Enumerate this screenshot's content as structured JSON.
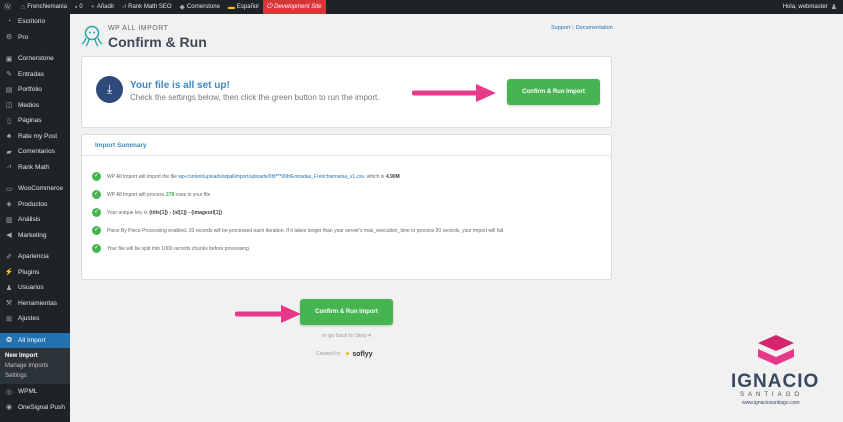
{
  "admin_bar": {
    "site_name": "Frenchiemania",
    "comments_count": "0",
    "add_new": "Añadir",
    "rank_math": "Rank Math SEO",
    "cornerstone": "Cornerstone",
    "language": "Español",
    "dev_site": "Development Site",
    "greeting": "Hola, webmaster"
  },
  "sidebar": {
    "items": [
      "Escritorio",
      "Pro",
      "Cornerstone",
      "Entradas",
      "Portfolio",
      "Medios",
      "Páginas",
      "Rate my Post",
      "Comentarios",
      "Rank Math",
      "WooCommerce",
      "Productos",
      "Análisis",
      "Marketing",
      "Apariencia",
      "Plugins",
      "Usuarios",
      "Herramientas",
      "Ajustes",
      "All Import"
    ],
    "submenu": [
      "New Import",
      "Manage Imports",
      "Settings"
    ],
    "after": [
      "WPML",
      "OneSignal Push"
    ]
  },
  "header": {
    "small_title": "WP ALL IMPORT",
    "big_title": "Confirm & Run"
  },
  "top_links": {
    "support": "Support",
    "separator": "|",
    "documentation": "Documentation"
  },
  "card1": {
    "title": "Your file is all set up!",
    "subtitle": "Check the settings below, then click the green button to run the import.",
    "button": "Confirm & Run Import"
  },
  "summary": {
    "heading": "Import Summary",
    "line1_pre": "WP All Import will import the file",
    "line1_link": "wp-content/uploads/wpallimport/uploads/0fd***00b/Entradas_Frenchiemania_v1.csv",
    "line1_mid": ", which is",
    "line1_size": "4.90M",
    "line2_pre": "WP All Import will process",
    "line2_count": "278",
    "line2_post": "rows in your file",
    "line3_pre": "Your unique key is",
    "line3_key": "{title[1]} - {id[1]} - {imageurl[1]}",
    "line4": "Piece By Piece Processing enabled. 20 records will be processed each iteration. If it takes longer than your server's max_execution_time to process 20 records, your import will fail.",
    "line5": "Your file will be split into 1000 records chunks before processing."
  },
  "bottom": {
    "button": "Confirm & Run Import",
    "go_back": "or go back to Step 4",
    "created_by": "Created by",
    "brand": "soflyy"
  },
  "watermark": {
    "name": "IGNACIO",
    "sub": "SANTIAGO",
    "url": "www.ignaciosantiago.com"
  },
  "colors": {
    "accent_green": "#46b450",
    "arrow_pink": "#e8388a",
    "title_blue": "#3f89bf"
  }
}
